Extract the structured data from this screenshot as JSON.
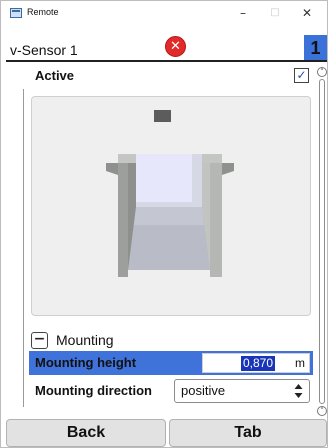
{
  "window": {
    "title": "Remote",
    "icons": {
      "app": "remote-app-icon",
      "minimize": "minimize-icon",
      "maximize": "maximize-icon",
      "close": "close-icon"
    },
    "minimize_glyph": "–",
    "maximize_glyph": "□",
    "close_glyph": "✕"
  },
  "sensor": {
    "name": "v-Sensor 1",
    "status_icon": "error-icon",
    "status_glyph": "✕",
    "number": "1"
  },
  "active": {
    "label": "Active",
    "checked": true,
    "check_glyph": "✓"
  },
  "mounting": {
    "section_label": "Mounting",
    "collapse_glyph": "−",
    "height": {
      "label": "Mounting height",
      "value": "0,870",
      "unit": "m"
    },
    "direction": {
      "label": "Mounting direction",
      "value": "positive"
    }
  },
  "scrollbar": {
    "up_glyph": "˄",
    "down_glyph": "˅"
  },
  "buttons": {
    "back": "Back",
    "tab": "Tab"
  },
  "colors": {
    "accent_blue": "#3f73d9",
    "selection_blue": "#1a36b8",
    "error_red": "#e12b2b",
    "panel_bg": "#efefef"
  }
}
